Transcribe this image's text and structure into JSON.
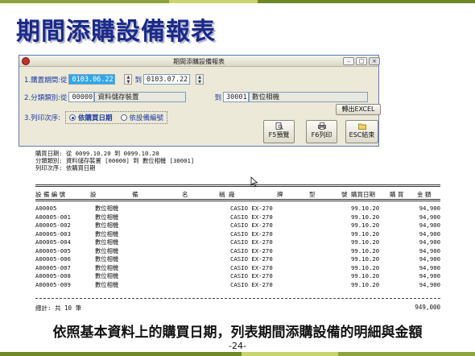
{
  "slide": {
    "title": "期間添購設備報表",
    "caption": "依照基本資料上的購買日期，列表期間添購設備的明細與金額",
    "page_number": "-24-"
  },
  "window": {
    "title": "期間添購設備報表",
    "controls": {
      "minimize": "–",
      "maximize": "□",
      "close": "×"
    },
    "form": {
      "period_label": "1.購置期間:從",
      "period_from": "0103.06.22",
      "period_to_label": "到",
      "period_to": "0103.07.22",
      "category_label": "2.分類類別:從",
      "category_from_code": "00000",
      "category_from_name": "資料儲存裝置",
      "category_to_label": "到",
      "category_to_code": "30001",
      "category_to_name": "數位相機",
      "export_button": "轉出EXCEL",
      "order_label": "3.列印次序:",
      "order_options": [
        "依購買日期",
        "依設備編號"
      ],
      "order_selected": "依購買日期",
      "buttons": {
        "preview": "F5預覽",
        "print": "F6列印",
        "exit": "ESC結束"
      }
    }
  },
  "report": {
    "header_lines": [
      "購買日期: 從 0099.10.20 到 0099.10.20",
      "分類類別: 資料儲存裝置 [00000] 到 數位相機 [30001]",
      "列印次序: 依購買日期"
    ],
    "columns": [
      "設 備 編 號",
      "設",
      "備",
      "名",
      "稱",
      "廠",
      "牌",
      "型",
      "號",
      "購買日期",
      "購 買",
      "金 額"
    ],
    "rows": [
      {
        "id": "A00005",
        "name": "數位相機",
        "brand": "CASIO EX-270",
        "date": "99.10.20",
        "amount": "94,900"
      },
      {
        "id": "A00005-001",
        "name": "數位相機",
        "brand": "CASIO EX-270",
        "date": "99.10.20",
        "amount": "94,900"
      },
      {
        "id": "A00005-002",
        "name": "數位相機",
        "brand": "CASIO EX-270",
        "date": "99.10.20",
        "amount": "94,900"
      },
      {
        "id": "A00005-003",
        "name": "數位相機",
        "brand": "CASIO EX-270",
        "date": "99.10.20",
        "amount": "94,900"
      },
      {
        "id": "A00005-004",
        "name": "數位相機",
        "brand": "CASIO EX-270",
        "date": "99.10.20",
        "amount": "94,900"
      },
      {
        "id": "A00005-005",
        "name": "數位相機",
        "brand": "CASIO EX-270",
        "date": "99.10.20",
        "amount": "94,900"
      },
      {
        "id": "A00005-006",
        "name": "數位相機",
        "brand": "CASIO EX-270",
        "date": "99.10.20",
        "amount": "94,900"
      },
      {
        "id": "A00005-007",
        "name": "數位相機",
        "brand": "CASIO EX-270",
        "date": "99.10.20",
        "amount": "94,900"
      },
      {
        "id": "A00005-008",
        "name": "數位相機",
        "brand": "CASIO EX-270",
        "date": "99.10.20",
        "amount": "94,900"
      },
      {
        "id": "A00005-009",
        "name": "數位相機",
        "brand": "CASIO EX-270",
        "date": "99.10.20",
        "amount": "94,900"
      }
    ],
    "total_label": "總計: 共 10 筆",
    "total_amount": "949,000"
  }
}
